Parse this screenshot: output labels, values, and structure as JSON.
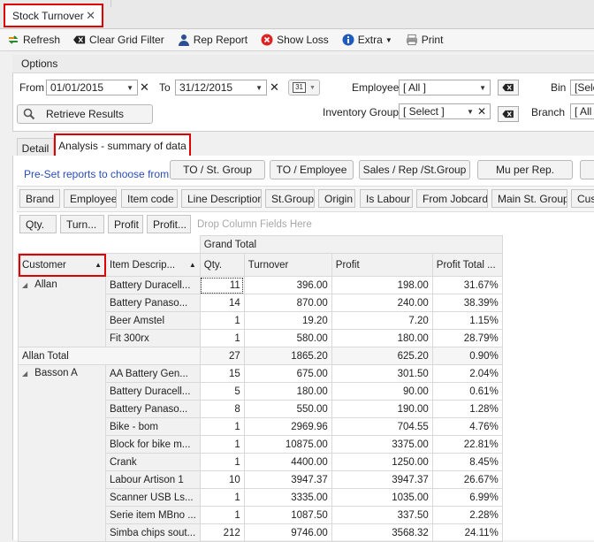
{
  "doc_tab": {
    "title": "Stock Turnover",
    "close": "✕"
  },
  "toolbar": {
    "refresh": "Refresh",
    "clear_grid_filter": "Clear Grid Filter",
    "rep_report": "Rep Report",
    "show_loss": "Show Loss",
    "extra": "Extra",
    "print": "Print"
  },
  "options": {
    "title": "Options",
    "from_label": "From",
    "from_value": "01/01/2015",
    "to_label": "To",
    "to_value": "31/12/2015",
    "calendar_day": "31",
    "employee_label": "Employee",
    "employee_value": "[ All ]",
    "bin_label": "Bin",
    "bin_value": "[Sele",
    "retrieve_button": "Retrieve Results",
    "inventory_group_label": "Inventory Group",
    "inventory_group_value": "[ Select ]",
    "branch_label": "Branch",
    "branch_value": "[ All ]"
  },
  "subtabs": {
    "detail": "Detail",
    "analysis": "Analysis - summary of data"
  },
  "presets": {
    "label": "Pre-Set reports to choose from:",
    "buttons": [
      "TO / St. Group",
      "TO / Employee",
      "Sales / Rep /St.Group",
      "Mu per Rep."
    ]
  },
  "filter_fields": [
    "Brand",
    "Employee",
    "Item code",
    "Line Description",
    "St.Group",
    "Origin",
    "Is Labour",
    "From Jobcard",
    "Main St. Group",
    "Cust"
  ],
  "data_fields": [
    "Qty.",
    "Turn...",
    "Profit",
    "Profit..."
  ],
  "drop_hint": "Drop Column Fields Here",
  "grid": {
    "grand_total": "Grand Total",
    "row_headers": [
      "Customer",
      "Item Descrip..."
    ],
    "col_headers": [
      "Qty.",
      "Turnover",
      "Profit",
      "Profit Total ..."
    ],
    "groups": [
      {
        "customer": "Allan",
        "rows": [
          [
            "Battery Duracell...",
            "11",
            "396.00",
            "198.00",
            "31.67%"
          ],
          [
            "Battery Panaso...",
            "14",
            "870.00",
            "240.00",
            "38.39%"
          ],
          [
            "Beer Amstel",
            "1",
            "19.20",
            "7.20",
            "1.15%"
          ],
          [
            "Fit 300rx",
            "1",
            "580.00",
            "180.00",
            "28.79%"
          ]
        ],
        "total_label": "Allan Total",
        "total": [
          "27",
          "1865.20",
          "625.20",
          "0.90%"
        ]
      },
      {
        "customer": "Basson A",
        "rows": [
          [
            "AA Battery Gen...",
            "15",
            "675.00",
            "301.50",
            "2.04%"
          ],
          [
            "Battery Duracell...",
            "5",
            "180.00",
            "90.00",
            "0.61%"
          ],
          [
            "Battery Panaso...",
            "8",
            "550.00",
            "190.00",
            "1.28%"
          ],
          [
            "Bike - bom",
            "1",
            "2969.96",
            "704.55",
            "4.76%"
          ],
          [
            "Block for bike m...",
            "1",
            "10875.00",
            "3375.00",
            "22.81%"
          ],
          [
            "Crank",
            "1",
            "4400.00",
            "1250.00",
            "8.45%"
          ],
          [
            "Labour Artison 1",
            "10",
            "3947.37",
            "3947.37",
            "26.67%"
          ],
          [
            "Scanner USB Ls...",
            "1",
            "3335.00",
            "1035.00",
            "6.99%"
          ],
          [
            "Serie item MBno ...",
            "1",
            "1087.50",
            "337.50",
            "2.28%"
          ],
          [
            "Simba chips sout...",
            "212",
            "9746.00",
            "3568.32",
            "24.11%"
          ]
        ]
      }
    ]
  }
}
